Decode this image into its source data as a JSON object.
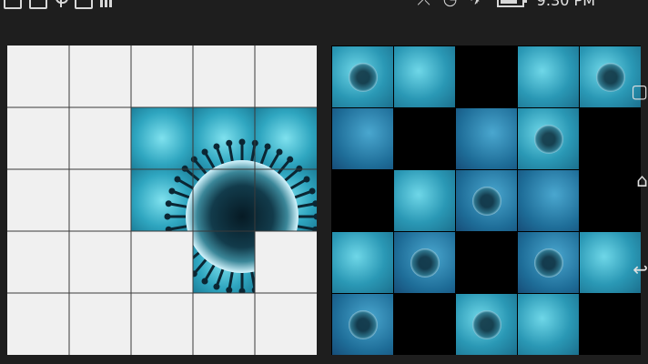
{
  "status_bar": {
    "time": "9:30 PM",
    "battery_level": 0.85,
    "left_icons": [
      "image-icon",
      "code-icon",
      "usb-icon",
      "code-icon",
      "signal-bars-icon"
    ],
    "right_icons": [
      "no-sync-icon",
      "wifi-icon",
      "airplane-icon",
      "battery-icon"
    ]
  },
  "puzzle": {
    "grid_size": 5,
    "target_filled_cells": [
      [
        1,
        2
      ],
      [
        1,
        3
      ],
      [
        1,
        4
      ],
      [
        2,
        2
      ],
      [
        2,
        3
      ],
      [
        2,
        4
      ],
      [
        3,
        3
      ]
    ],
    "tiles": [
      [
        "blue",
        "blue",
        "empty",
        "blue",
        "blue"
      ],
      [
        "deep",
        "empty",
        "deep",
        "blue",
        "empty"
      ],
      [
        "empty",
        "blue",
        "deep",
        "deep",
        "empty"
      ],
      [
        "blue",
        "deep",
        "empty",
        "deep",
        "blue"
      ],
      [
        "deep",
        "empty",
        "blue",
        "blue",
        "empty"
      ]
    ]
  },
  "nav": {
    "icons": [
      "recent-apps-icon",
      "home-icon",
      "back-icon"
    ]
  }
}
